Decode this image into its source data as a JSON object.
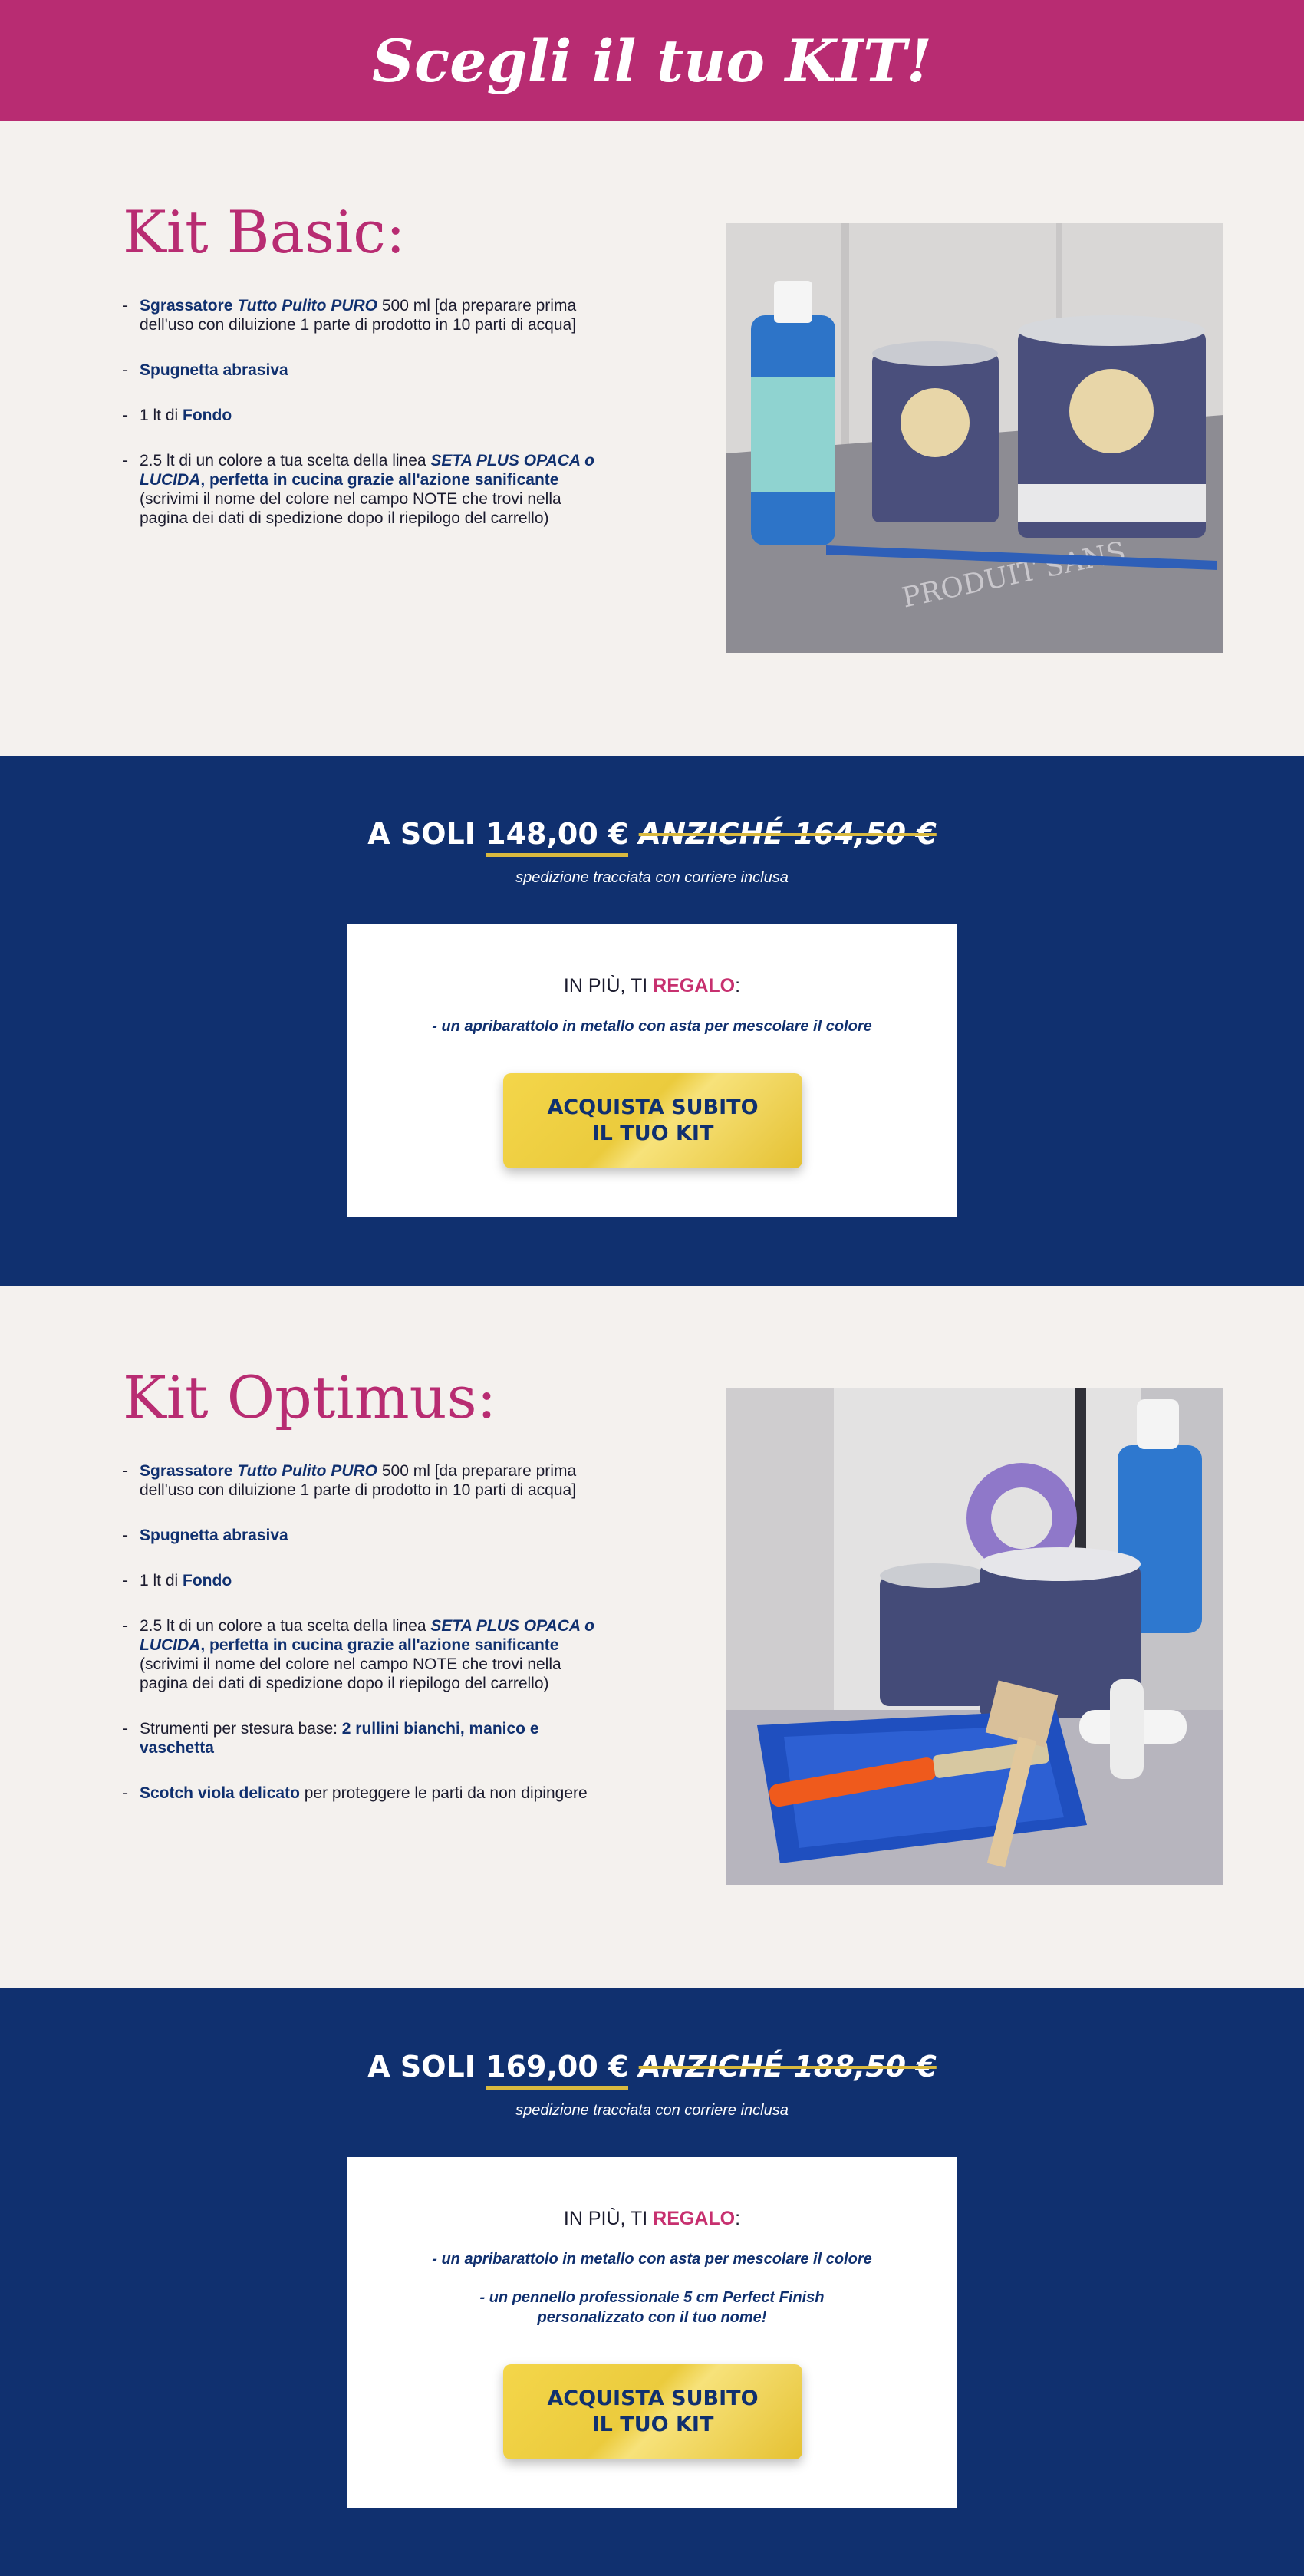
{
  "header": {
    "title": "Scegli il tuo KIT!"
  },
  "colors": {
    "brand_pink": "#b82c72",
    "navy": "#10306f",
    "gold": "#e9c83a",
    "cream": "#f4f1ee"
  },
  "kits": [
    {
      "title": "Kit Basic:",
      "features": [
        {
          "parts": [
            [
              "hl",
              "Sgrassatore "
            ],
            [
              "hli",
              "Tutto Pulito PURO"
            ],
            [
              "n",
              " 500 ml [da preparare prima dell'uso con diluizione 1 parte di prodotto in 10 parti di acqua]"
            ]
          ]
        },
        {
          "parts": [
            [
              "hl",
              "Spugnetta abrasiva"
            ]
          ]
        },
        {
          "parts": [
            [
              "n",
              "1 lt di "
            ],
            [
              "hl",
              "Fondo"
            ]
          ]
        },
        {
          "parts": [
            [
              "n",
              "2.5 lt di un colore a tua scelta della linea "
            ],
            [
              "hli",
              "SETA PLUS OPACA o LUCIDA"
            ],
            [
              "hl",
              ", perfetta in cucina grazie all'azione sanificante"
            ],
            [
              "n",
              " (scrivimi il nome del colore nel campo NOTE che trovi nella pagina dei dati di spedizione dopo il riepilogo del carrello)"
            ]
          ]
        }
      ],
      "image_alt": "kit-basic-photo",
      "price_prefix": "A SOLI ",
      "price": "148,00 €",
      "old_price": "ANZICHÉ 164,50 €",
      "shipping": "spedizione tracciata con corriere inclusa",
      "gift_prefix": "IN PIÙ, TI ",
      "gift_accent": "REGALO",
      "gift_suffix": ":",
      "gifts": [
        "- un apribarattolo in metallo con asta per mescolare il colore"
      ],
      "button": "ACQUISTA SUBITO\nIL TUO KIT"
    },
    {
      "title": "Kit Optimus:",
      "features": [
        {
          "parts": [
            [
              "hl",
              "Sgrassatore "
            ],
            [
              "hli",
              "Tutto Pulito PURO"
            ],
            [
              "n",
              " 500 ml [da preparare prima dell'uso con diluizione 1 parte di prodotto in 10 parti di acqua]"
            ]
          ]
        },
        {
          "parts": [
            [
              "hl",
              "Spugnetta abrasiva"
            ]
          ]
        },
        {
          "parts": [
            [
              "n",
              "1 lt di "
            ],
            [
              "hl",
              "Fondo"
            ]
          ]
        },
        {
          "parts": [
            [
              "n",
              "2.5 lt di un colore a tua scelta della linea "
            ],
            [
              "hli",
              "SETA PLUS OPACA o LUCIDA"
            ],
            [
              "hl",
              ", perfetta in cucina grazie all'azione sanificante"
            ],
            [
              "n",
              " (scrivimi il nome del colore nel campo NOTE che trovi nella pagina dei dati di spedizione dopo il riepilogo del carrello)"
            ]
          ]
        },
        {
          "parts": [
            [
              "n",
              "Strumenti per stesura base: "
            ],
            [
              "hl",
              "2 rullini bianchi, manico e vaschetta"
            ]
          ]
        },
        {
          "parts": [
            [
              "hl",
              "Scotch viola delicato"
            ],
            [
              "n",
              " per proteggere le parti da non dipingere"
            ]
          ]
        }
      ],
      "image_alt": "kit-optimus-photo",
      "price_prefix": "A SOLI ",
      "price": "169,00 €",
      "old_price": "ANZICHÉ 188,50 €",
      "shipping": "spedizione tracciata con corriere inclusa",
      "gift_prefix": "IN PIÙ, TI ",
      "gift_accent": "REGALO",
      "gift_suffix": ":",
      "gifts": [
        "- un apribarattolo in metallo con asta per mescolare il colore",
        "- un pennello professionale 5 cm Perfect Finish\npersonalizzato con il tuo nome!"
      ],
      "button": "ACQUISTA SUBITO\nIL TUO KIT"
    }
  ]
}
